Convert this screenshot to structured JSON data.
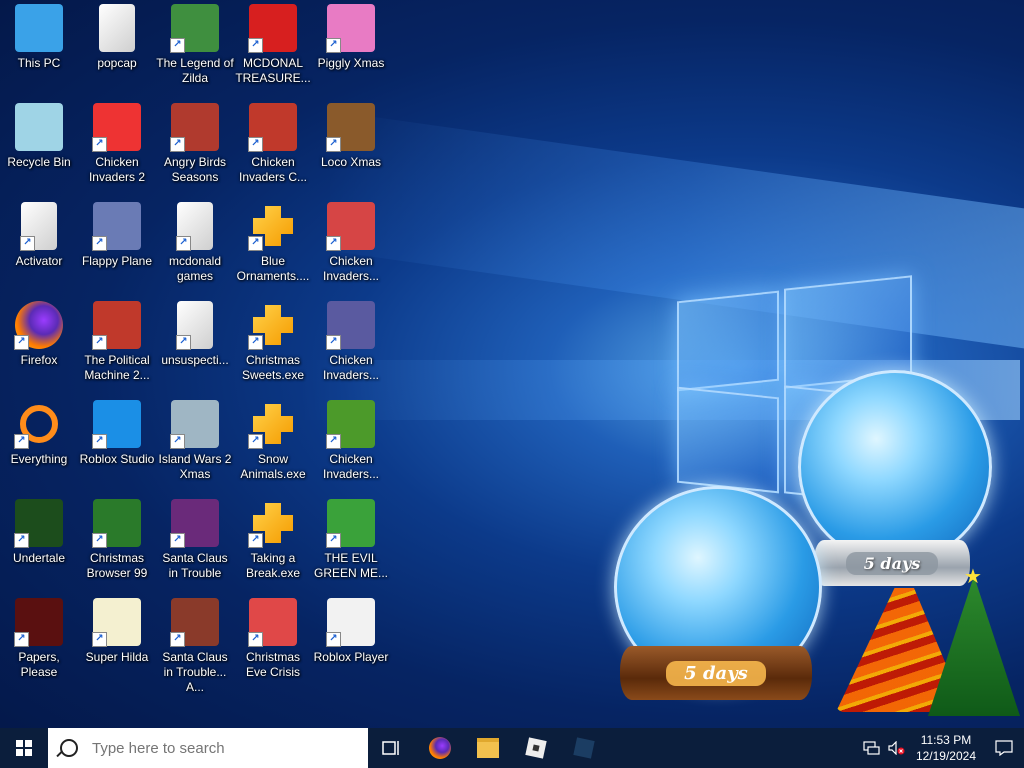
{
  "desktop": {
    "icons": [
      {
        "label": "This PC",
        "icon": "computer-icon",
        "color": "#3aa2e8"
      },
      {
        "label": "popcap",
        "icon": "folder-icon",
        "color": "#e9c46a"
      },
      {
        "label": "The Legend of Zilda",
        "icon": "game-character-icon",
        "color": "#3f8f3f"
      },
      {
        "label": "MCDONAL TREASURE...",
        "icon": "mcdonalds-icon",
        "color": "#d71f1f"
      },
      {
        "label": "Piggly Xmas",
        "icon": "pig-icon",
        "color": "#e87bc4"
      },
      {
        "label": "Recycle Bin",
        "icon": "recycle-bin-icon",
        "color": "#9fd4e6"
      },
      {
        "label": "Chicken Invaders 2",
        "icon": "chicken-icon",
        "color": "#e33"
      },
      {
        "label": "Angry Birds Seasons",
        "icon": "angry-bird-icon",
        "color": "#b03a2e"
      },
      {
        "label": "Chicken Invaders C...",
        "icon": "chicken-snowman-icon",
        "color": "#c0392b"
      },
      {
        "label": "Loco Xmas",
        "icon": "teddy-bear-icon",
        "color": "#8a5a2b"
      },
      {
        "label": "Activator",
        "icon": "file-icon",
        "color": "#e8e8e8"
      },
      {
        "label": "Flappy Plane",
        "icon": "plane-icon",
        "color": "#6a7bb5"
      },
      {
        "label": "mcdonald games",
        "icon": "file-icon",
        "color": "#e8e8e8"
      },
      {
        "label": "Blue Ornaments....",
        "icon": "installer-icon",
        "color": "#f5b800"
      },
      {
        "label": "Chicken Invaders...",
        "icon": "chicken-santa-icon",
        "color": "#d64545"
      },
      {
        "label": "Firefox",
        "icon": "firefox-icon",
        "color": "#ff7b00"
      },
      {
        "label": "The Political Machine 2...",
        "icon": "political-machine-icon",
        "color": "#c0392b"
      },
      {
        "label": "unsuspecti...",
        "icon": "file-icon",
        "color": "#e8e8e8"
      },
      {
        "label": "Christmas Sweets.exe",
        "icon": "installer-icon",
        "color": "#f5b800"
      },
      {
        "label": "Chicken Invaders...",
        "icon": "spaceship-icon",
        "color": "#5a5aa0"
      },
      {
        "label": "Everything",
        "icon": "magnifier-icon",
        "color": "#ff8c1a"
      },
      {
        "label": "Roblox Studio",
        "icon": "roblox-studio-icon",
        "color": "#1b8fe6"
      },
      {
        "label": "Island Wars 2 Xmas",
        "icon": "island-icon",
        "color": "#9fb6c4"
      },
      {
        "label": "Snow Animals.exe",
        "icon": "installer-icon",
        "color": "#f5b800"
      },
      {
        "label": "Chicken Invaders...",
        "icon": "chicken-green-icon",
        "color": "#4c9a2a"
      },
      {
        "label": "Undertale",
        "icon": "undertale-icon",
        "color": "#1c4d1c"
      },
      {
        "label": "Christmas Browser 99",
        "icon": "christmas-tree-icon",
        "color": "#2a7a2a"
      },
      {
        "label": "Santa Claus in Trouble",
        "icon": "santa-icon",
        "color": "#6a2a7a"
      },
      {
        "label": "Taking a Break.exe",
        "icon": "installer-icon",
        "color": "#f5b800"
      },
      {
        "label": "THE EVIL GREEN ME...",
        "icon": "msn-icon",
        "color": "#3aa23a"
      },
      {
        "label": "Papers, Please",
        "icon": "papers-please-icon",
        "color": "#5a1010"
      },
      {
        "label": "Super Hilda",
        "icon": "pixel-dog-icon",
        "color": "#f4f0d0"
      },
      {
        "label": "Santa Claus in Trouble... A...",
        "icon": "santa-icon",
        "color": "#8a3a2a"
      },
      {
        "label": "Christmas Eve Crisis",
        "icon": "santa-face-icon",
        "color": "#e04848"
      },
      {
        "label": "Roblox Player",
        "icon": "roblox-player-icon",
        "color": "#f2f2f2"
      }
    ],
    "widget_left": "5 days",
    "widget_right": "5 days"
  },
  "taskbar": {
    "search_placeholder": "Type here to search",
    "time": "11:53 PM",
    "date": "12/19/2024"
  }
}
